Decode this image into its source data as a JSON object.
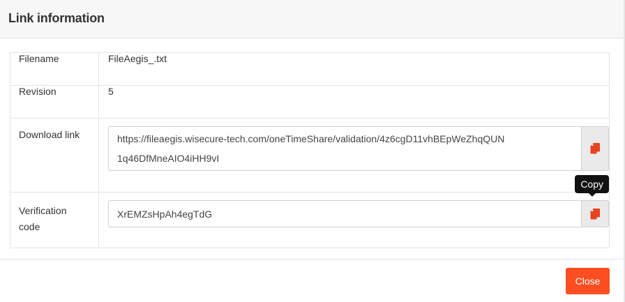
{
  "modal": {
    "title": "Link information",
    "close_label": "Close"
  },
  "rows": {
    "filename": {
      "label": "Filename",
      "value": "FileAegis_.txt"
    },
    "revision": {
      "label": "Revision",
      "value": "5"
    },
    "download": {
      "label": "Download link",
      "value": "https://fileaegis.wisecure-tech.com/oneTimeShare/validation/4z6cgD11vhBEpWeZhqQUN1q46DfMneAIO4iHH9vI"
    },
    "verification": {
      "label": "Verification code",
      "value": "XrEMZsHpAh4egTdG"
    }
  },
  "tooltip": {
    "text": "Copy"
  },
  "colors": {
    "accent": "#fd4d21",
    "icon": "#e8431f"
  },
  "icons": {
    "copy": "copy-icon"
  }
}
